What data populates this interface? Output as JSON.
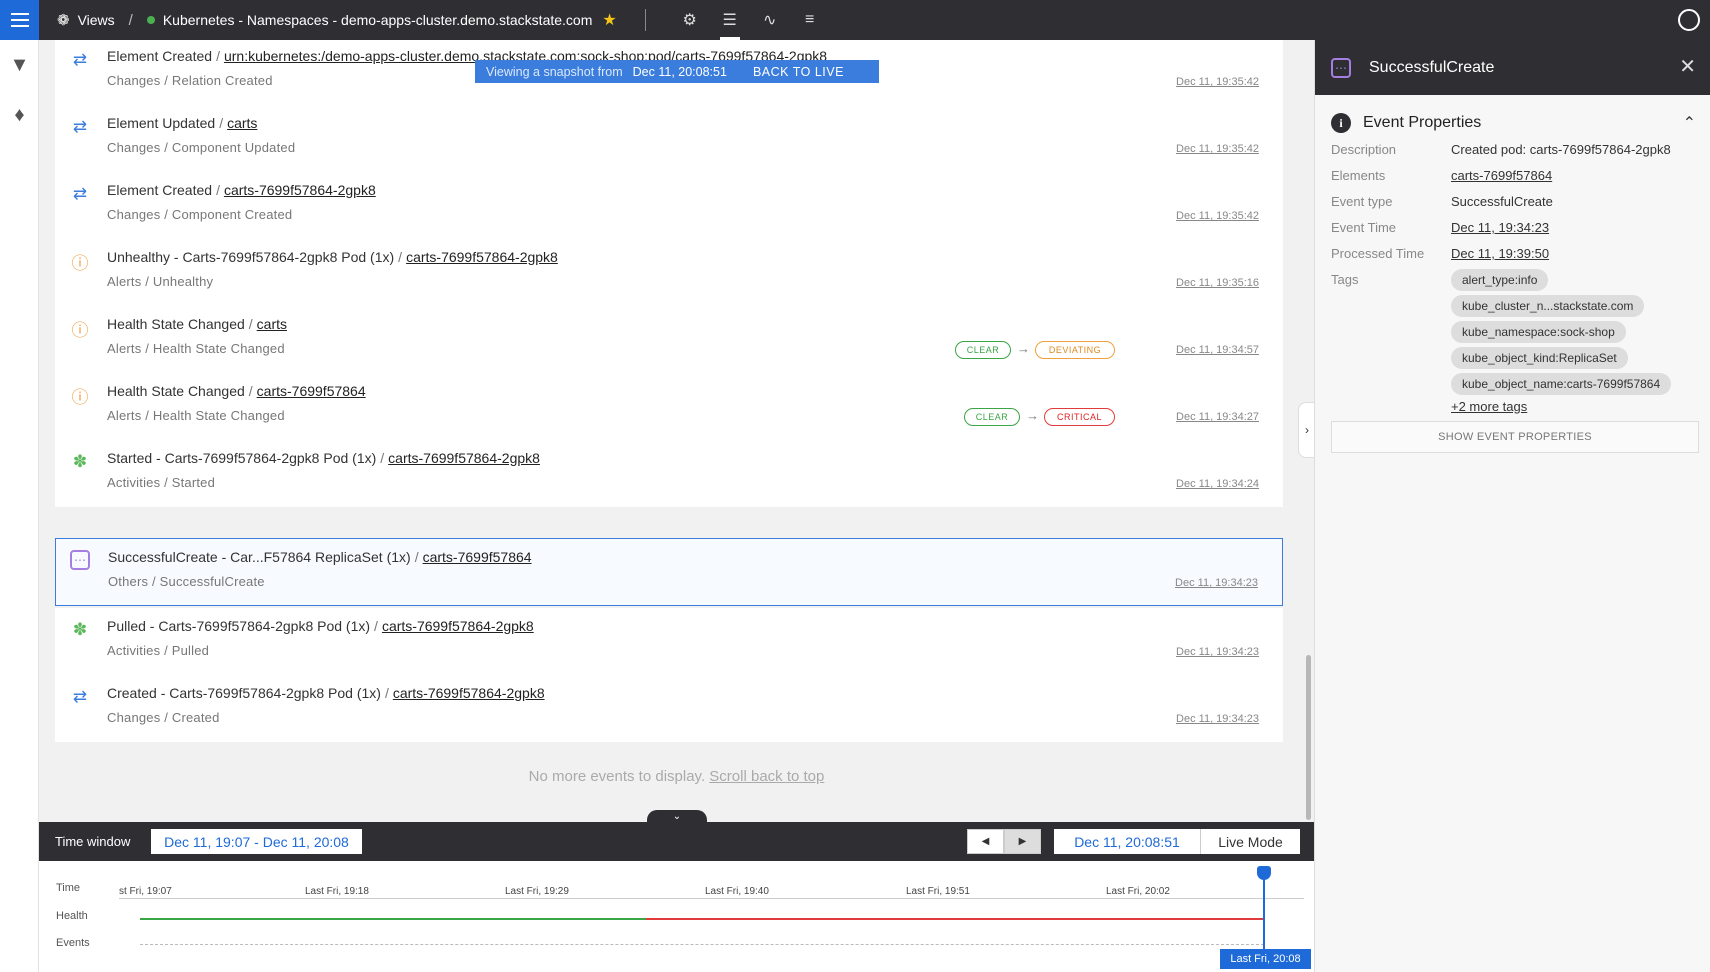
{
  "topbar": {
    "views_label": "Views",
    "view_title": "Kubernetes - Namespaces - demo-apps-cluster.demo.stackstate.com",
    "icons": [
      "menu-icon",
      "views-icon",
      "star-icon",
      "topology-icon",
      "events-icon",
      "metrics-icon",
      "traces-icon",
      "user-icon"
    ]
  },
  "snapshot_banner": {
    "prefix": "Viewing a snapshot from",
    "time": "Dec 11, 20:08:51",
    "back_label": "BACK TO LIVE"
  },
  "events": [
    {
      "type_icon": "change-arrows-icon",
      "icon_color": "#3b7ddd",
      "title": "Element Created",
      "target": "urn:kubernetes:/demo-apps-cluster.demo.stackstate.com:sock-shop:pod/carts-7699f57864-2gpk8",
      "subtitle": "Changes / Relation Created",
      "time": "Dec 11, 19:35:42"
    },
    {
      "type_icon": "change-arrows-icon",
      "icon_color": "#3b7ddd",
      "title": "Element Updated",
      "target": "carts",
      "subtitle": "Changes / Component Updated",
      "time": "Dec 11, 19:35:42"
    },
    {
      "type_icon": "change-arrows-icon",
      "icon_color": "#3b7ddd",
      "title": "Element Created",
      "target": "carts-7699f57864-2gpk8",
      "subtitle": "Changes / Component Created",
      "time": "Dec 11, 19:35:42"
    },
    {
      "type_icon": "alert-icon",
      "icon_color": "#f0a040",
      "title": "Unhealthy - Carts-7699f57864-2gpk8 Pod (1x)",
      "target": "carts-7699f57864-2gpk8",
      "subtitle": "Alerts / Unhealthy",
      "time": "Dec 11, 19:35:16"
    },
    {
      "type_icon": "alert-icon",
      "icon_color": "#f0a040",
      "title": "Health State Changed",
      "target": "carts",
      "subtitle": "Alerts / Health State Changed",
      "time": "Dec 11, 19:34:57",
      "from_state": "CLEAR",
      "to_state": "DEVIATING"
    },
    {
      "type_icon": "alert-icon",
      "icon_color": "#f0a040",
      "title": "Health State Changed",
      "target": "carts-7699f57864",
      "subtitle": "Alerts / Health State Changed",
      "time": "Dec 11, 19:34:27",
      "from_state": "CLEAR",
      "to_state": "CRITICAL"
    },
    {
      "type_icon": "activity-icon",
      "icon_color": "#5cb85c",
      "title": "Started - Carts-7699f57864-2gpk8 Pod (1x)",
      "target": "carts-7699f57864-2gpk8",
      "subtitle": "Activities / Started",
      "time": "Dec 11, 19:34:24"
    },
    {
      "type_icon": "other-dots-icon",
      "icon_color": "#a47ee0",
      "title": "SuccessfulCreate - Car...F57864 ReplicaSet (1x)",
      "target": "carts-7699f57864",
      "subtitle": "Others / SuccessfulCreate",
      "time": "Dec 11, 19:34:23",
      "selected": true
    },
    {
      "type_icon": "activity-icon",
      "icon_color": "#5cb85c",
      "title": "Pulled - Carts-7699f57864-2gpk8 Pod (1x)",
      "target": "carts-7699f57864-2gpk8",
      "subtitle": "Activities / Pulled",
      "time": "Dec 11, 19:34:23"
    },
    {
      "type_icon": "change-arrows-icon",
      "icon_color": "#3b7ddd",
      "title": "Created - Carts-7699f57864-2gpk8 Pod (1x)",
      "target": "carts-7699f57864-2gpk8",
      "subtitle": "Changes / Created",
      "time": "Dec 11, 19:34:23"
    }
  ],
  "events_footer": {
    "text": "No more events to display.",
    "link": "Scroll back to top"
  },
  "detail_panel": {
    "title": "SuccessfulCreate",
    "section_title": "Event Properties",
    "properties": [
      {
        "key": "Description",
        "value": "Created pod: carts-7699f57864-2gpk8",
        "link": false
      },
      {
        "key": "Elements",
        "value": "carts-7699f57864",
        "link": true
      },
      {
        "key": "Event type",
        "value": "SuccessfulCreate",
        "link": false
      },
      {
        "key": "Event Time",
        "value": "Dec 11, 19:34:23",
        "link": true
      },
      {
        "key": "Processed Time",
        "value": "Dec 11, 19:39:50",
        "link": true
      }
    ],
    "tags_label": "Tags",
    "tags": [
      "alert_type:info",
      "kube_cluster_n...stackstate.com",
      "kube_namespace:sock-shop",
      "kube_object_kind:ReplicaSet",
      "kube_object_name:carts-7699f57864"
    ],
    "more_tags": "+2 more tags",
    "show_button": "SHOW EVENT PROPERTIES"
  },
  "time_window": {
    "label": "Time window",
    "range": "Dec 11, 19:07 - Dec 11, 20:08",
    "current_time": "Dec 11, 20:08:51",
    "live_mode": "Live Mode"
  },
  "timeline": {
    "row_labels": [
      "Time",
      "Health",
      "Events"
    ],
    "ticks": [
      "st Fri, 19:07",
      "Last Fri, 19:18",
      "Last Fri, 19:29",
      "Last Fri, 19:40",
      "Last Fri, 19:51",
      "Last Fri, 20:02"
    ],
    "now_label": "Last Fri, 20:08",
    "health_segments": [
      {
        "state": "clear",
        "color": "#3aa545"
      },
      {
        "state": "critical",
        "color": "#e23b3b"
      }
    ]
  }
}
